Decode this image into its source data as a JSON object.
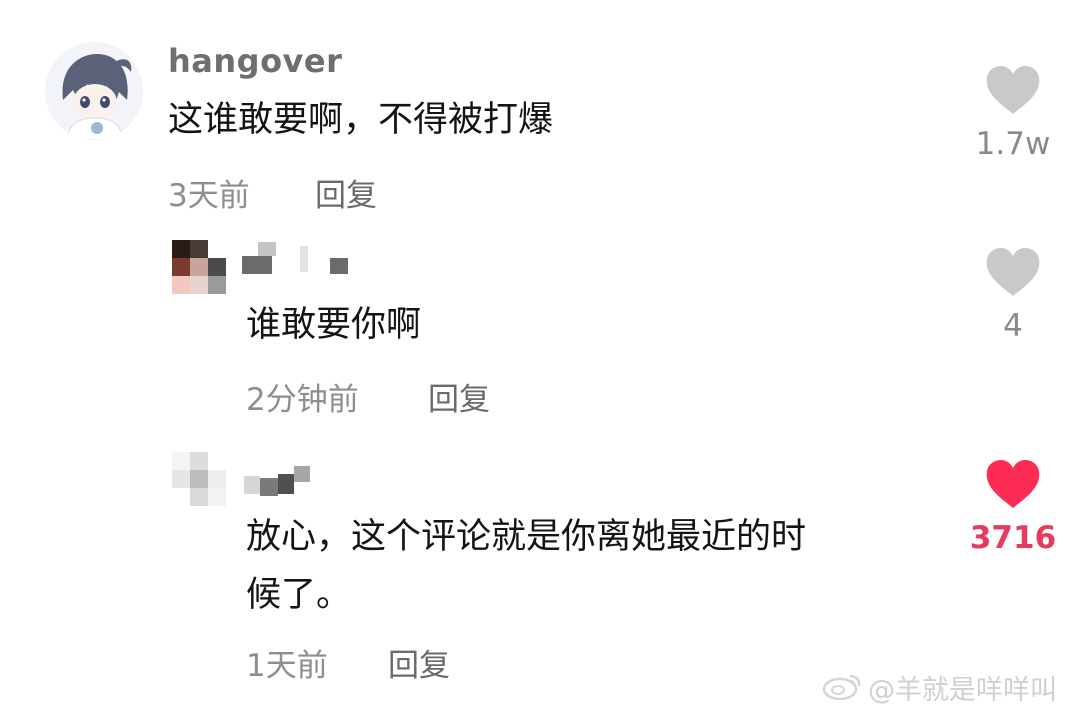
{
  "comments": [
    {
      "username": "hangover",
      "text": "这谁敢要啊，不得被打爆",
      "time": "3天前",
      "reply_label": "回复",
      "likes": "1.7w",
      "liked": false
    },
    {
      "username": "",
      "text": "谁敢要你啊",
      "time": "2分钟前",
      "reply_label": "回复",
      "likes": "4",
      "liked": false
    },
    {
      "username": "",
      "text_line1": "放心，这个评论就是你离她最近的时",
      "text_line2": "候了。",
      "time": "1天前",
      "reply_label": "回复",
      "likes": "3716",
      "liked": true
    }
  ],
  "watermark": "@羊就是咩咩叫",
  "colors": {
    "heart_inactive": "#c9c9c9",
    "heart_active": "#fe2c55",
    "count_active": "#e83a5c"
  },
  "icons": {
    "like": "heart-icon",
    "watermark_logo": "weibo-logo-icon"
  }
}
